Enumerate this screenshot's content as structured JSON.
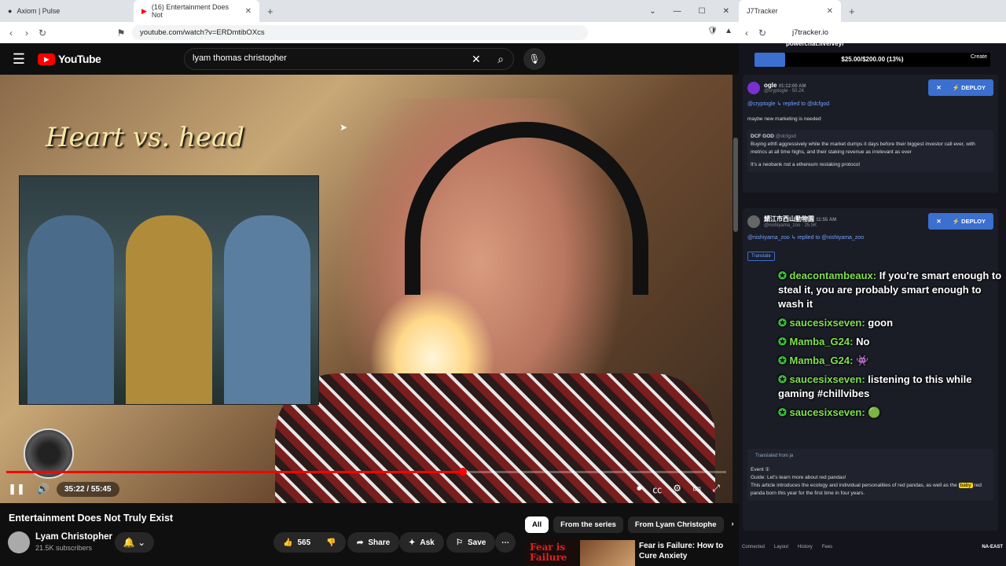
{
  "browser": {
    "tabs": [
      {
        "title": "Axiom | Pulse"
      },
      {
        "title": "(16) Entertainment Does Not"
      }
    ],
    "url": "youtube.com/watch?v=ERDmtibOXcs",
    "tab2_title": "J7Tracker",
    "url2": "j7tracker.io"
  },
  "youtube": {
    "logo": "YouTube",
    "search_value": "lyam thomas christopher",
    "video": {
      "overlay_title": "Heart vs. head",
      "time": "35:22 / 55:45",
      "progress": 0.634
    },
    "title": "Entertainment Does Not Truly Exist",
    "channel": "Lyam Christopher",
    "subscribers": "21.5K subscribers",
    "likes": "565",
    "share": "Share",
    "ask": "Ask",
    "save": "Save",
    "chips": [
      "All",
      "From the series",
      "From Lyam Christophe"
    ],
    "rec_thumb_text": "Fear is Failure",
    "rec_title": "Fear is Failure: How to Cure Anxiety"
  },
  "sidebar": {
    "powerchat": "powerchat.live/veyr",
    "budget": "$25.00/$200.00 (13%)",
    "budget_fraction": 0.13,
    "create": "Create",
    "cards": [
      {
        "name": "ogle",
        "time": "01:12:00 AM",
        "handle": "@cryptogle",
        "followers": "50.2K",
        "deploy": "DEPLOY",
        "reply": "@cryptogle ↳ replied to @dcfgod",
        "text": "maybe new marketing is needed",
        "quote_name": "DCF GOD",
        "quote_handle": "@dcfgod",
        "quote_text": "Buying ethfi aggressively while the market dumps it days before their biggest investor call ever, with metrics at all time highs, and their staking revenue as irrelevant as ever",
        "quote_text2": "It's a neobank not a ethereum restaking protocol"
      },
      {
        "name": "鯖江市西山動物園",
        "time": "11:55 AM",
        "handle": "@nishiyama_zoo",
        "followers": "25.5K",
        "deploy": "DEPLOY",
        "reply": "@nishiyama_zoo ↳ replied to @nishiyama_zoo",
        "translate": "Translate",
        "translated_from": "Translated from ja",
        "event": "Event ①",
        "guide": "Guide: Let's learn more about red pandas!",
        "article": "This article introduces the ecology and individual personalities of red pandas, as well as the",
        "baby": "baby",
        "article2": "red panda born this year for the first time in four years."
      }
    ],
    "chat": [
      {
        "user": "deacontambeaux:",
        "msg": "If you're smart enough to steal it, you are probably smart enough to wash it"
      },
      {
        "user": "saucesixseven:",
        "msg": "goon"
      },
      {
        "user": "Mamba_G24:",
        "msg": "No"
      },
      {
        "user": "Mamba_G24:",
        "msg": "👾"
      },
      {
        "user": "saucesixseven:",
        "msg": "listening to this while gaming #chillvibes"
      },
      {
        "user": "saucesixseven:",
        "msg": "🟢"
      }
    ],
    "bottom": {
      "connected": "Connected",
      "layout": "Layout",
      "history": "History",
      "fees": "Fees",
      "region": "NA-EAST"
    }
  }
}
